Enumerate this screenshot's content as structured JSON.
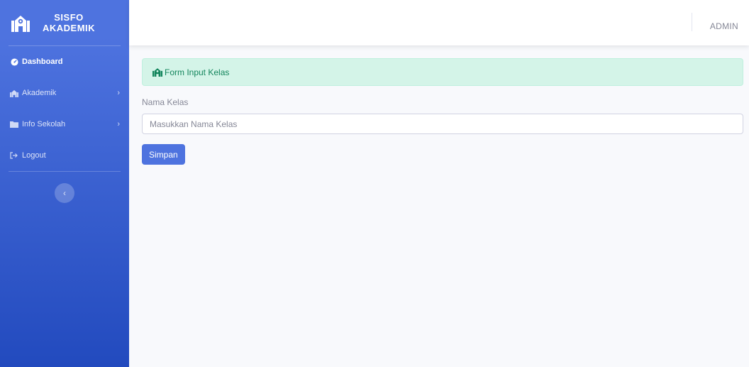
{
  "brand": {
    "line1": "SISFO",
    "line2": "AKADEMIK",
    "icon": "school-icon"
  },
  "sidebar": {
    "items": [
      {
        "label": "Dashboard",
        "icon": "tachometer-icon",
        "active": true
      },
      {
        "label": "Akademik",
        "icon": "school-icon",
        "has_submenu": true
      },
      {
        "label": "Info Sekolah",
        "icon": "folder-icon",
        "has_submenu": true
      },
      {
        "label": "Logout",
        "icon": "sign-out-icon"
      }
    ],
    "toggle_icon": "chevron-left-icon"
  },
  "topbar": {
    "user": "ADMIN"
  },
  "alert": {
    "text": "Form Input Kelas",
    "icon": "school-icon"
  },
  "form": {
    "label": "Nama Kelas",
    "placeholder": "Masukkan Nama Kelas",
    "value": "",
    "submit_label": "Simpan"
  },
  "colors": {
    "primary": "#4e73df",
    "sidebar_gradient_end": "#224abe",
    "success_bg": "#d4f4e8",
    "success_text": "#13855c",
    "page_bg": "#f8f9fc"
  }
}
